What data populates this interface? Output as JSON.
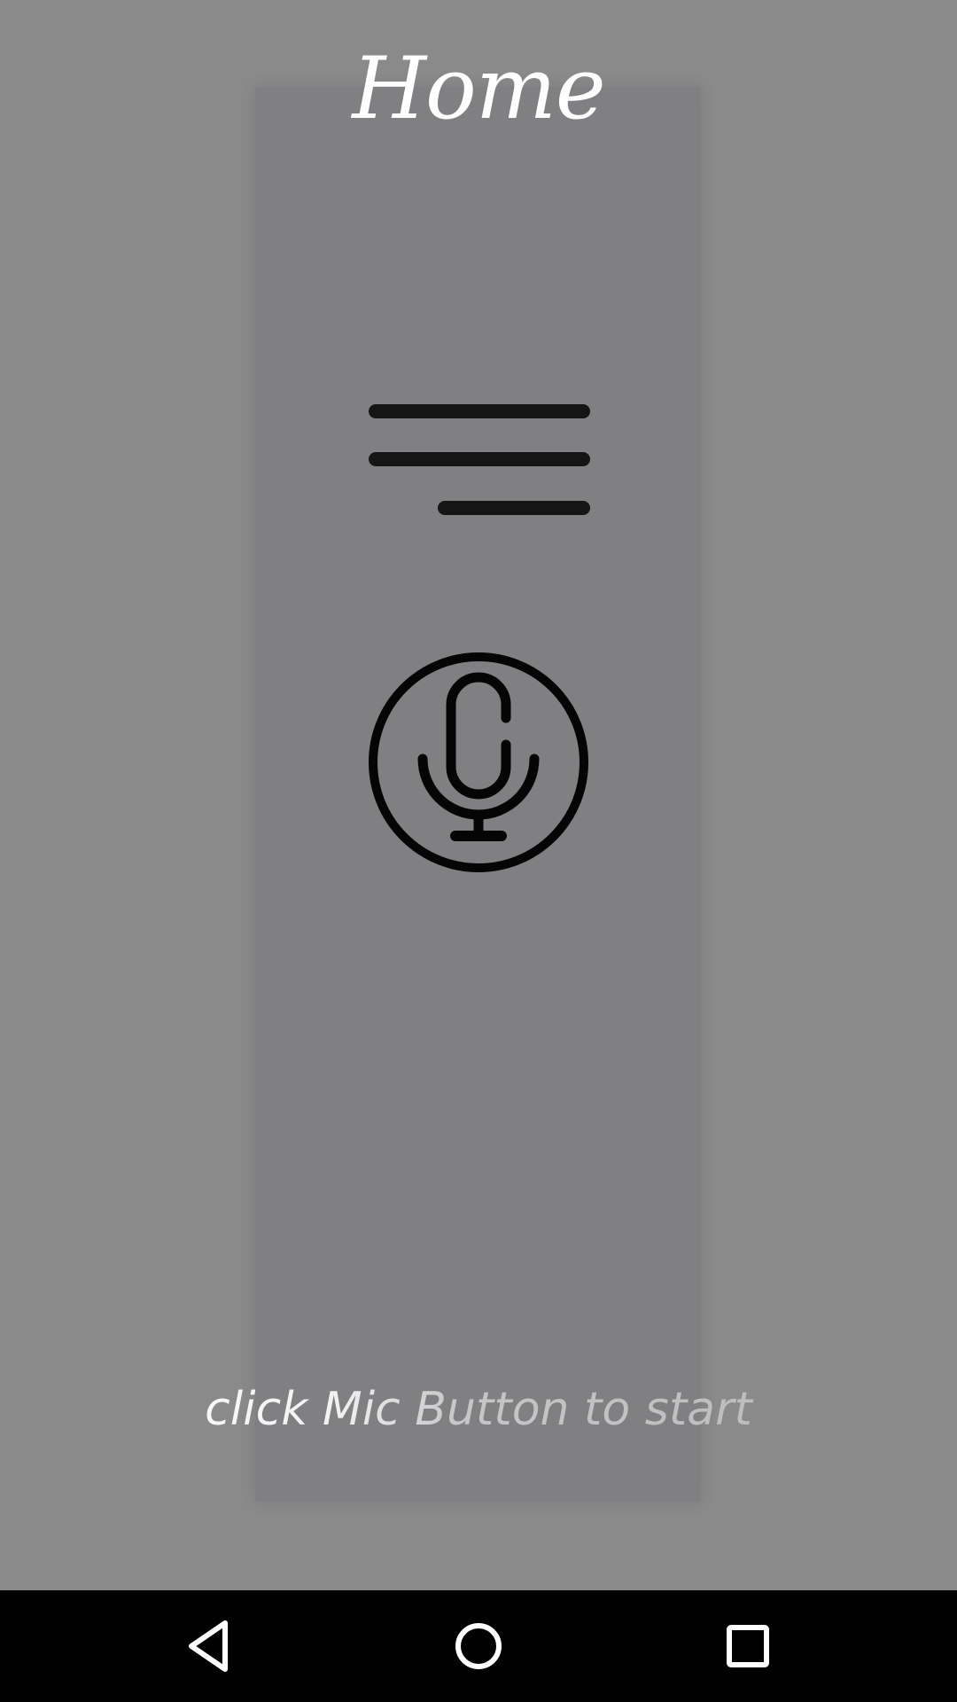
{
  "header": {
    "title": "Home"
  },
  "main": {
    "menu_icon": "menu-icon",
    "mic_icon": "microphone-icon",
    "hint": "click Mic Button to start"
  },
  "navigation_bar": {
    "back_icon": "back-triangle-icon",
    "home_icon": "home-circle-icon",
    "recents_icon": "recents-square-icon"
  },
  "colors": {
    "background": "#8a8a8a",
    "card": "#807f82",
    "icon": "#0f0f0f",
    "title_text": "#ffffff",
    "nav_bar": "#000000"
  }
}
